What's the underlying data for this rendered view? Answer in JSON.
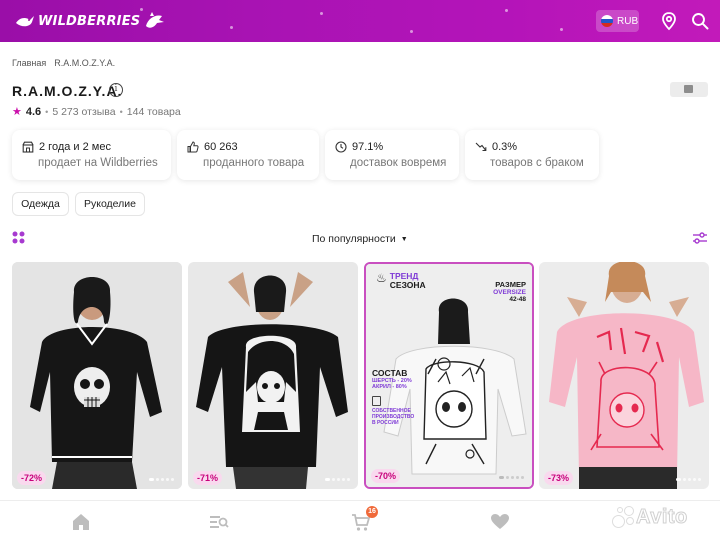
{
  "header": {
    "logo_text": "WILDBERRIES",
    "currency": "RUB",
    "colors": {
      "brand_start": "#9a0ea8",
      "brand_end": "#c21aba"
    }
  },
  "breadcrumb": [
    "Главная",
    "R.A.M.O.Z.Y.A."
  ],
  "seller": {
    "name": "R.A.M.O.Z.Y.A.",
    "rating": "4.6",
    "reviews": "5 273 отзыва",
    "products": "144 товара"
  },
  "stats": [
    {
      "icon": "shop-icon",
      "value": "2 года и 2 мес",
      "label": "продает на Wildberries"
    },
    {
      "icon": "thumbs-up-icon",
      "value": "60 263",
      "label": "проданного товара"
    },
    {
      "icon": "clock-icon",
      "value": "97.1%",
      "label": "доставок вовремя"
    },
    {
      "icon": "trend-down-icon",
      "value": "0.3%",
      "label": "товаров с браком"
    }
  ],
  "categories": [
    "Одежда",
    "Рукоделие"
  ],
  "sort": {
    "label": "По популярности"
  },
  "products": [
    {
      "discount": "-72%",
      "colors": "black sweater with skull",
      "dots": 5,
      "active_dot": 0
    },
    {
      "discount": "-71%",
      "colors": "black sweater with anime girl",
      "dots": 5,
      "active_dot": 0
    },
    {
      "discount": "-70%",
      "dots": 5,
      "active_dot": 0,
      "promo": {
        "trend": [
          "ТРЕНД",
          "СЕЗОНА"
        ],
        "size_title": "РАЗМЕР",
        "size_type": "OVERSIZE",
        "size_range": "42-48",
        "composition_title": "СОСТАВ",
        "composition": [
          "ШЕРСТЬ - 20%",
          "АКРИЛ - 80%"
        ],
        "production": [
          "СОБСТВЕННОЕ",
          "ПРОИЗВОДСТВО",
          "В РОССИИ"
        ]
      }
    },
    {
      "discount": "-73%",
      "colors": "pink sweater with red anime print",
      "dots": 5,
      "active_dot": 0
    }
  ],
  "bottom_nav": {
    "items": [
      "home-icon",
      "catalog-icon",
      "cart-icon",
      "favorites-icon",
      "profile-icon"
    ],
    "cart_count": "16"
  },
  "watermark": "Avito"
}
